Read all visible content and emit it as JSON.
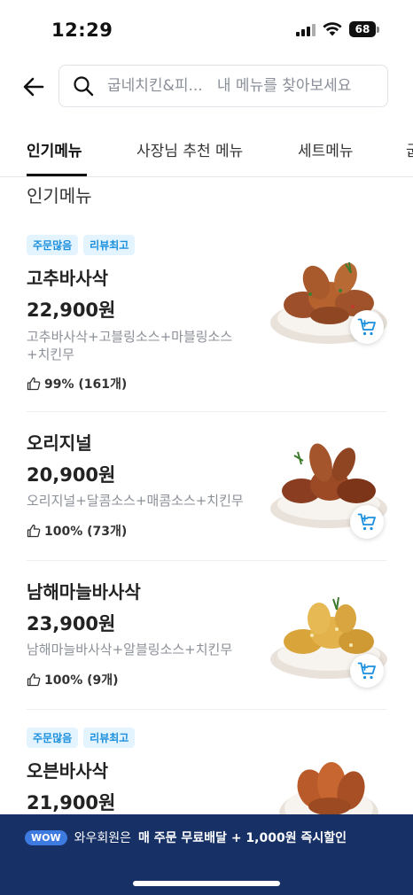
{
  "status": {
    "time": "12:29",
    "battery": "68"
  },
  "header": {
    "back_icon": "arrow-left-icon",
    "search_placeholder": "굽네치킨&피...   내 메뉴를 찾아보세요"
  },
  "tabs": [
    {
      "label": "인기메뉴",
      "active": true
    },
    {
      "label": "사장님 추천 메뉴",
      "active": false
    },
    {
      "label": "세트메뉴",
      "active": false
    },
    {
      "label": "굽",
      "active": false
    }
  ],
  "section_title": "인기메뉴",
  "items": [
    {
      "badges": [
        "주문많음",
        "리뷰최고"
      ],
      "name": "고추바사삭",
      "price": "22,900원",
      "desc": "고추바사삭+고블링소스+마블링소스+치킨무",
      "rating": "99% (161개)"
    },
    {
      "badges": [],
      "name": "오리지널",
      "price": "20,900원",
      "desc": "오리지널+달콤소스+매콤소스+치킨무",
      "rating": "100% (73개)"
    },
    {
      "badges": [],
      "name": "남해마늘바사삭",
      "price": "23,900원",
      "desc": "남해마늘바사삭+알블링소스+치킨무",
      "rating": "100% (9개)"
    },
    {
      "badges": [
        "주문많음",
        "리뷰최고"
      ],
      "name": "오븐바사삭",
      "price": "21,900원",
      "desc": "",
      "rating": ""
    }
  ],
  "promo": {
    "badge": "WOW",
    "text": "와우회원은",
    "strong": "매 주문 무료배달 + 1,000원 즉시할인"
  },
  "colors": {
    "accent": "#1a8fdd",
    "banner": "#173166",
    "badge_bg": "#e4f4ff"
  }
}
